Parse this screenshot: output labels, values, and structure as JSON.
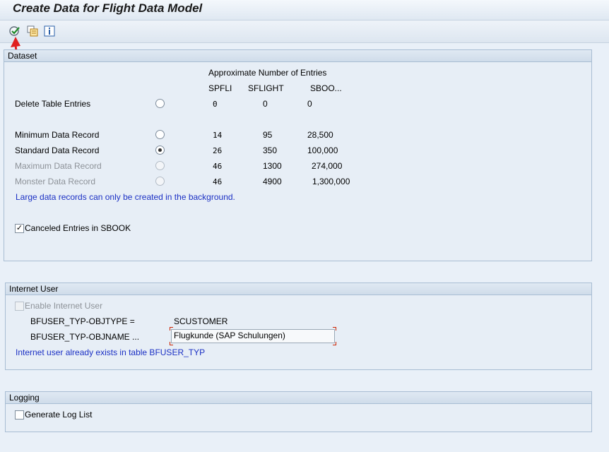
{
  "window": {
    "title": "Create Data for Flight Data Model"
  },
  "toolbar": {
    "execute_icon": "execute-icon",
    "variants_icon": "get-variant-icon",
    "info_icon": "program-info-icon"
  },
  "dataset": {
    "title": "Dataset",
    "approx_label": "Approximate Number of Entries",
    "columns": [
      "SPFLI",
      "SFLIGHT",
      "SBOO..."
    ],
    "rows": [
      {
        "label": "Delete Table Entries",
        "spfli": "0",
        "sflight": "0",
        "sbook": "0",
        "selected": false,
        "enabled": true
      },
      {
        "label": "Minimum Data Record",
        "spfli": "14",
        "sflight": "95",
        "sbook": "28,500",
        "selected": false,
        "enabled": true
      },
      {
        "label": "Standard Data Record",
        "spfli": "26",
        "sflight": "350",
        "sbook": "100,000",
        "selected": true,
        "enabled": true
      },
      {
        "label": "Maximum Data Record",
        "spfli": "46",
        "sflight": "1300",
        "sbook": "274,000",
        "selected": false,
        "enabled": false
      },
      {
        "label": "Monster Data Record",
        "spfli": "46",
        "sflight": "4900",
        "sbook": "1,300,000",
        "selected": false,
        "enabled": false
      }
    ],
    "background_note": "Large data records can only be created in the background.",
    "canceled_entries_label": "Canceled Entries in SBOOK",
    "canceled_entries_checked": true
  },
  "internet_user": {
    "title": "Internet User",
    "enable_label": "Enable Internet User",
    "enable_checked": false,
    "objtype_label": "BFUSER_TYP-OBJTYPE =",
    "objtype_value": "SCUSTOMER",
    "objname_label": "BFUSER_TYP-OBJNAME ...",
    "objname_value": "Flugkunde (SAP Schulungen)",
    "exists_note": "Internet user already exists in table BFUSER_TYP"
  },
  "logging": {
    "title": "Logging",
    "generate_log_label": "Generate Log List",
    "generate_log_checked": false
  },
  "colors": {
    "info_text": "#1b30c4",
    "annotation_arrow": "#e02020"
  }
}
